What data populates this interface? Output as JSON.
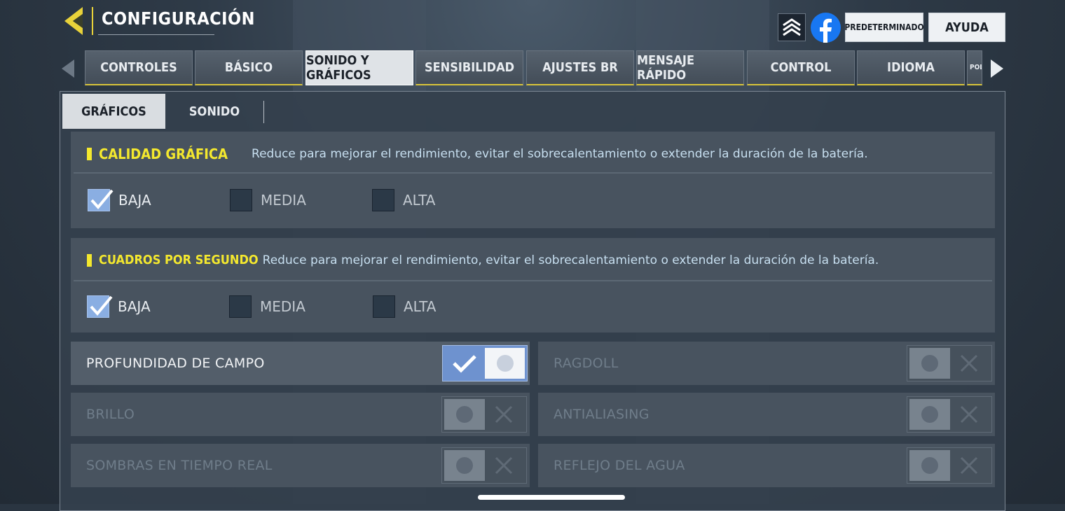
{
  "header": {
    "title": "CONFIGURACIÓN",
    "default_button": "PREDETERMINADO",
    "help_button": "AYUDA"
  },
  "tabs": [
    {
      "label": "CONTROLES"
    },
    {
      "label": "BÁSICO"
    },
    {
      "label": "SONIDO Y GRÁFICOS",
      "active": true
    },
    {
      "label": "SENSIBILIDAD"
    },
    {
      "label": "AJUSTES BR"
    },
    {
      "label": "MENSAJE RÁPIDO"
    },
    {
      "label": "CONTROL"
    },
    {
      "label": "IDIOMA"
    },
    {
      "label": "POLÍ"
    }
  ],
  "sub_tabs": [
    {
      "label": "GRÁFICOS",
      "active": true
    },
    {
      "label": "SONIDO"
    }
  ],
  "sections": [
    {
      "title": "CALIDAD GRÁFICA",
      "description": "Reduce para mejorar el rendimiento, evitar el sobrecalentamiento o extender la duración de la batería.",
      "options": [
        {
          "label": "BAJA",
          "checked": true
        },
        {
          "label": "MEDIA",
          "checked": false
        },
        {
          "label": "ALTA",
          "checked": false
        }
      ]
    },
    {
      "title": "CUADROS POR SEGUNDO",
      "description": "Reduce para mejorar el rendimiento, evitar el sobrecalentamiento o extender la duración de la batería.",
      "options": [
        {
          "label": "BAJA",
          "checked": true
        },
        {
          "label": "MEDIA",
          "checked": false
        },
        {
          "label": "ALTA",
          "checked": false
        }
      ]
    }
  ],
  "toggles": [
    {
      "label": "PROFUNDIDAD DE CAMPO",
      "on": true
    },
    {
      "label": "RAGDOLL",
      "on": false
    },
    {
      "label": "BRILLO",
      "on": false
    },
    {
      "label": "ANTIALIASING",
      "on": false
    },
    {
      "label": "SOMBRAS EN TIEMPO REAL",
      "on": false
    },
    {
      "label": "REFLEJO DEL AGUA",
      "on": false
    }
  ],
  "colors": {
    "accent_yellow": "#f4e82e",
    "toggle_on": "#6e92cf",
    "checkbox_checked": "#8aaee2",
    "description_text": "#c7dff0"
  },
  "icons": {
    "back": "back-arrow-icon",
    "rank": "rank-chevrons-icon",
    "facebook": "facebook-icon"
  }
}
